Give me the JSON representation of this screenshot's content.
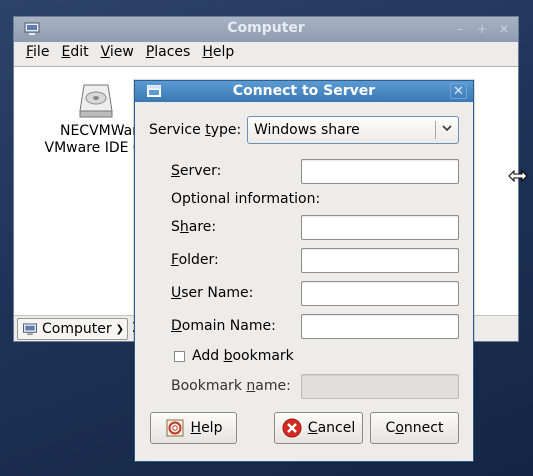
{
  "background_window": {
    "title": "Computer",
    "menu": [
      "File",
      "Edit",
      "View",
      "Places",
      "Help"
    ],
    "drive_label_line1": "NECVMWar",
    "drive_label_line2": "VMware IDE CD",
    "location_label": "Computer",
    "status_fragment": "2"
  },
  "dialog": {
    "title": "Connect to Server",
    "service_type_label": "Service type:",
    "service_type_value": "Windows share",
    "server_label": "Server:",
    "optional_header": "Optional information:",
    "share_label": "Share:",
    "folder_label": "Folder:",
    "user_name_label": "User Name:",
    "domain_name_label": "Domain Name:",
    "add_bookmark_label": "Add bookmark",
    "add_bookmark_checked": false,
    "bookmark_name_label": "Bookmark name:",
    "fields": {
      "server": "",
      "share": "",
      "folder": "",
      "user_name": "",
      "domain_name": "",
      "bookmark_name": ""
    },
    "buttons": {
      "help": "Help",
      "cancel": "Cancel",
      "connect": "Connect"
    }
  },
  "colors": {
    "dialog_title_bar": "#3a79b4",
    "background_title_bar": "#8e9bb0",
    "cancel_icon": "#d62b23"
  }
}
